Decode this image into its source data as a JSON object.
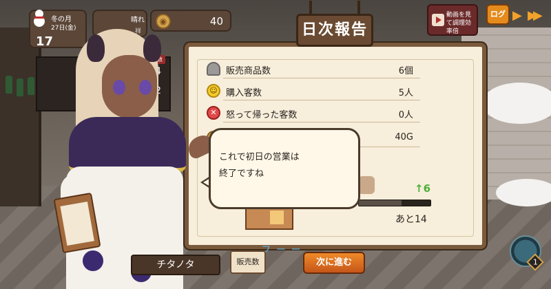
{
  "hud": {
    "season": "冬の月",
    "date": "27日(金)",
    "big_number": "17",
    "weather": "晴れ",
    "weather_sub": "祥",
    "gold": "40"
  },
  "top_buttons": {
    "video_label": "動画を見て調理効率倍",
    "log_label": "ログ"
  },
  "side_panel": {
    "tag": "販売数",
    "count1": "4",
    "count2": "2"
  },
  "report": {
    "title": "日次報告",
    "rows": [
      {
        "icon": "cloche-icon",
        "label": "販売商品数",
        "value": "6個"
      },
      {
        "icon": "smile-icon",
        "label": "購入客数",
        "value": "5人"
      },
      {
        "icon": "angry-icon",
        "label": "怒って帰った客数",
        "value": "0人"
      },
      {
        "icon": "gold-icon",
        "label": "",
        "value": "40G"
      }
    ],
    "level_up": "↑6",
    "progress_fraction": 0.6,
    "remaining": "あと14"
  },
  "dialog": {
    "line1": "これで初日の営業は",
    "line2": "終了ですね"
  },
  "bottom": {
    "character_name": "チタノタ",
    "sales_button": "販売数",
    "next_button": "次に進む",
    "level": "1"
  },
  "colors": {
    "accent_orange": "#e58a1c",
    "panel_bg": "#f7eedb",
    "panel_border": "#7a5a3c",
    "level_up_green": "#4caf3a"
  }
}
